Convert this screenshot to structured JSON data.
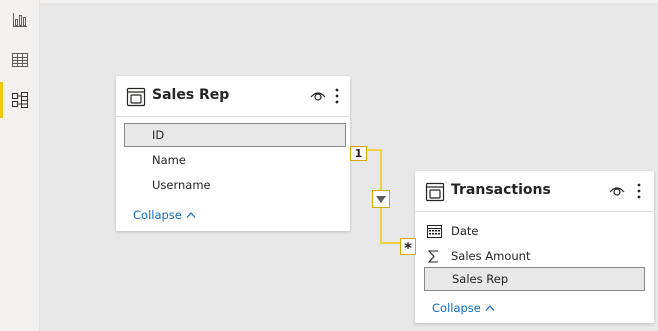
{
  "nav": {
    "items": [
      {
        "name": "report-view",
        "icon": "bar-chart-icon"
      },
      {
        "name": "data-view",
        "icon": "table-grid-icon"
      },
      {
        "name": "model-view",
        "icon": "model-diagram-icon",
        "active": true
      }
    ],
    "accent_color": "#f2c811"
  },
  "tables": {
    "sales_rep": {
      "title": "Sales Rep",
      "fields": [
        {
          "label": "ID",
          "icon": "",
          "selected": true
        },
        {
          "label": "Name",
          "icon": "",
          "selected": false
        },
        {
          "label": "Username",
          "icon": "",
          "selected": false
        }
      ],
      "collapse_label": "Collapse"
    },
    "transactions": {
      "title": "Transactions",
      "fields": [
        {
          "label": "Date",
          "icon": "calendar-icon",
          "selected": false
        },
        {
          "label": "Sales Amount",
          "icon": "sigma-icon",
          "selected": false
        },
        {
          "label": "Sales Rep",
          "icon": "",
          "selected": true
        }
      ],
      "collapse_label": "Collapse"
    }
  },
  "relationship": {
    "one_side": "1",
    "many_side": "*",
    "line_color": "#f2c811"
  }
}
